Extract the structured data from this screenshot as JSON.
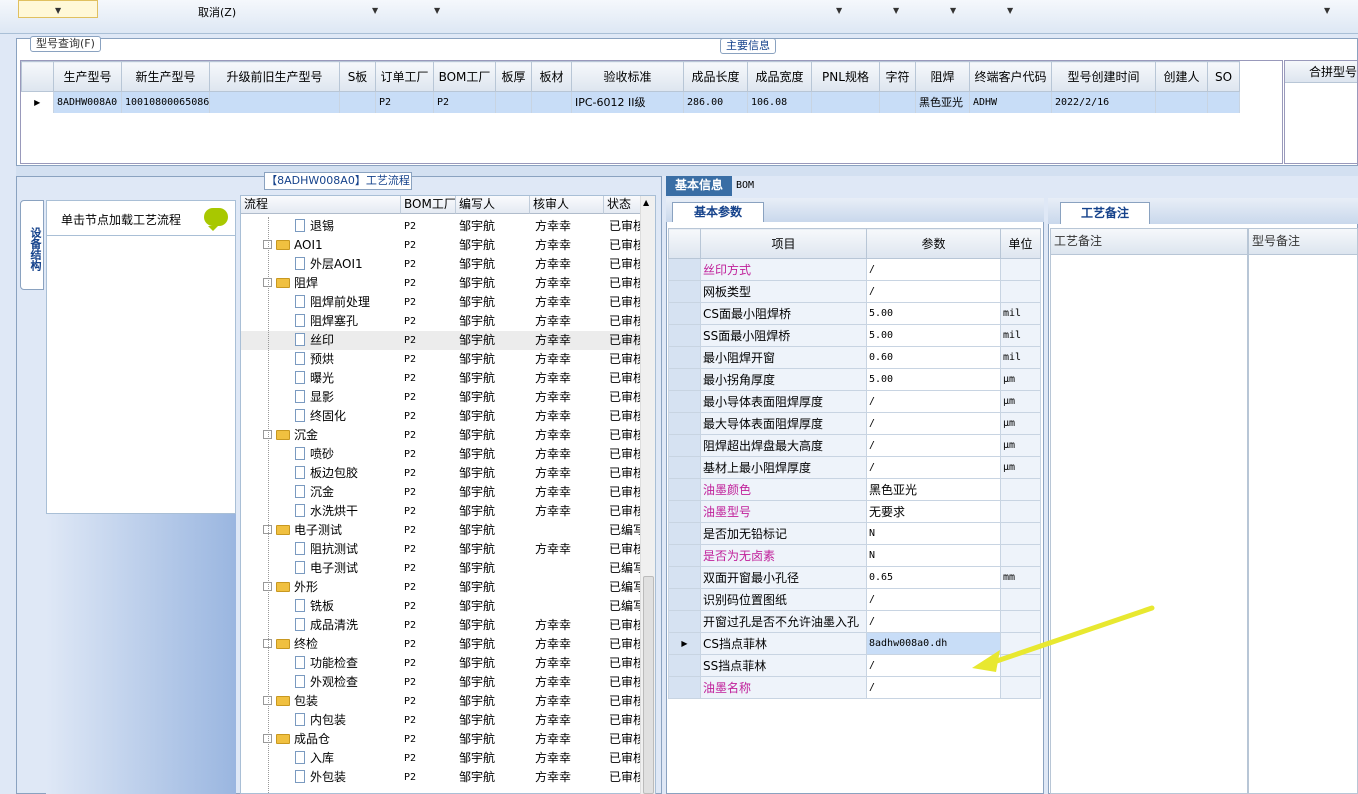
{
  "toolbar": {
    "cancel_label": "取消(Z)"
  },
  "search_panel": {
    "tab_label": "型号查询(F)",
    "main_info_label": "主要信息",
    "columns": [
      "生产型号",
      "新生产型号",
      "升级前旧生产型号",
      "S板",
      "订单工厂",
      "BOM工厂",
      "板厚",
      "板材",
      "验收标准",
      "成品长度",
      "成品宽度",
      "PNL规格",
      "字符",
      "阻焊",
      "终端客户代码",
      "型号创建时间",
      "创建人",
      "SO"
    ],
    "row": [
      "8ADHW008A0",
      "10010800065086",
      "",
      "",
      "P2",
      "P2",
      "",
      "",
      "IPC-6012 II级",
      "286.00",
      "106.08",
      "",
      "",
      "黑色亚光",
      "ADHW",
      "2022/2/16",
      "",
      ""
    ],
    "combine_label": "合拼型号"
  },
  "process": {
    "title": "【8ADHW008A0】工艺流程",
    "vertical_tab": "设备结构",
    "node_hint": "单击节点加载工艺流程",
    "columns": [
      "流程",
      "BOM工厂",
      "编写人",
      "核审人",
      "状态"
    ],
    "rows": [
      {
        "name": "退锡",
        "type": "doc",
        "indent": 2,
        "bom": "P2",
        "writer": "邹宇航",
        "reviewer": "方幸幸",
        "status": "已审核"
      },
      {
        "name": "AOI1",
        "type": "folder",
        "indent": 1,
        "bom": "P2",
        "writer": "邹宇航",
        "reviewer": "方幸幸",
        "status": "已审核"
      },
      {
        "name": "外层AOI1",
        "type": "doc",
        "indent": 2,
        "bom": "P2",
        "writer": "邹宇航",
        "reviewer": "方幸幸",
        "status": "已审核"
      },
      {
        "name": "阻焊",
        "type": "folder",
        "indent": 1,
        "bom": "P2",
        "writer": "邹宇航",
        "reviewer": "方幸幸",
        "status": "已审核"
      },
      {
        "name": "阻焊前处理",
        "type": "doc",
        "indent": 2,
        "bom": "P2",
        "writer": "邹宇航",
        "reviewer": "方幸幸",
        "status": "已审核"
      },
      {
        "name": "阻焊塞孔",
        "type": "doc",
        "indent": 2,
        "bom": "P2",
        "writer": "邹宇航",
        "reviewer": "方幸幸",
        "status": "已审核"
      },
      {
        "name": "丝印",
        "type": "doc",
        "indent": 2,
        "bom": "P2",
        "writer": "邹宇航",
        "reviewer": "方幸幸",
        "status": "已审核"
      },
      {
        "name": "预烘",
        "type": "doc",
        "indent": 2,
        "bom": "P2",
        "writer": "邹宇航",
        "reviewer": "方幸幸",
        "status": "已审核"
      },
      {
        "name": "曝光",
        "type": "doc",
        "indent": 2,
        "bom": "P2",
        "writer": "邹宇航",
        "reviewer": "方幸幸",
        "status": "已审核"
      },
      {
        "name": "显影",
        "type": "doc",
        "indent": 2,
        "bom": "P2",
        "writer": "邹宇航",
        "reviewer": "方幸幸",
        "status": "已审核"
      },
      {
        "name": "终固化",
        "type": "doc",
        "indent": 2,
        "bom": "P2",
        "writer": "邹宇航",
        "reviewer": "方幸幸",
        "status": "已审核"
      },
      {
        "name": "沉金",
        "type": "folder",
        "indent": 1,
        "bom": "P2",
        "writer": "邹宇航",
        "reviewer": "方幸幸",
        "status": "已审核"
      },
      {
        "name": "喷砂",
        "type": "doc",
        "indent": 2,
        "bom": "P2",
        "writer": "邹宇航",
        "reviewer": "方幸幸",
        "status": "已审核"
      },
      {
        "name": "板边包胶",
        "type": "doc",
        "indent": 2,
        "bom": "P2",
        "writer": "邹宇航",
        "reviewer": "方幸幸",
        "status": "已审核"
      },
      {
        "name": "沉金",
        "type": "doc",
        "indent": 2,
        "bom": "P2",
        "writer": "邹宇航",
        "reviewer": "方幸幸",
        "status": "已审核"
      },
      {
        "name": "水洗烘干",
        "type": "doc",
        "indent": 2,
        "bom": "P2",
        "writer": "邹宇航",
        "reviewer": "方幸幸",
        "status": "已审核"
      },
      {
        "name": "电子测试",
        "type": "folder",
        "indent": 1,
        "bom": "P2",
        "writer": "邹宇航",
        "reviewer": "",
        "status": "已编写"
      },
      {
        "name": "阻抗测试",
        "type": "doc",
        "indent": 2,
        "bom": "P2",
        "writer": "邹宇航",
        "reviewer": "方幸幸",
        "status": "已审核"
      },
      {
        "name": "电子测试",
        "type": "doc",
        "indent": 2,
        "bom": "P2",
        "writer": "邹宇航",
        "reviewer": "",
        "status": "已编写"
      },
      {
        "name": "外形",
        "type": "folder",
        "indent": 1,
        "bom": "P2",
        "writer": "邹宇航",
        "reviewer": "",
        "status": "已编写"
      },
      {
        "name": "铣板",
        "type": "doc",
        "indent": 2,
        "bom": "P2",
        "writer": "邹宇航",
        "reviewer": "",
        "status": "已编写"
      },
      {
        "name": "成品清洗",
        "type": "doc",
        "indent": 2,
        "bom": "P2",
        "writer": "邹宇航",
        "reviewer": "方幸幸",
        "status": "已审核"
      },
      {
        "name": "终检",
        "type": "folder",
        "indent": 1,
        "bom": "P2",
        "writer": "邹宇航",
        "reviewer": "方幸幸",
        "status": "已审核"
      },
      {
        "name": "功能检查",
        "type": "doc",
        "indent": 2,
        "bom": "P2",
        "writer": "邹宇航",
        "reviewer": "方幸幸",
        "status": "已审核"
      },
      {
        "name": "外观检查",
        "type": "doc",
        "indent": 2,
        "bom": "P2",
        "writer": "邹宇航",
        "reviewer": "方幸幸",
        "status": "已审核"
      },
      {
        "name": "包装",
        "type": "folder",
        "indent": 1,
        "bom": "P2",
        "writer": "邹宇航",
        "reviewer": "方幸幸",
        "status": "已审核"
      },
      {
        "name": "内包装",
        "type": "doc",
        "indent": 2,
        "bom": "P2",
        "writer": "邹宇航",
        "reviewer": "方幸幸",
        "status": "已审核"
      },
      {
        "name": "成品仓",
        "type": "folder",
        "indent": 1,
        "bom": "P2",
        "writer": "邹宇航",
        "reviewer": "方幸幸",
        "status": "已审核"
      },
      {
        "name": "入库",
        "type": "doc",
        "indent": 2,
        "bom": "P2",
        "writer": "邹宇航",
        "reviewer": "方幸幸",
        "status": "已审核"
      },
      {
        "name": "外包装",
        "type": "doc",
        "indent": 2,
        "bom": "P2",
        "writer": "邹宇航",
        "reviewer": "方幸幸",
        "status": "已审核"
      }
    ]
  },
  "basic_info": {
    "tab_basic": "基本信息",
    "tab_bom": "BOM",
    "sub_tab": "基本参数",
    "columns": [
      "项目",
      "参数",
      "单位"
    ],
    "rows": [
      {
        "label": "丝印方式",
        "value": "/",
        "unit": "",
        "pink": true
      },
      {
        "label": "网板类型",
        "value": "/",
        "unit": "",
        "pink": false
      },
      {
        "label": "CS面最小阻焊桥",
        "value": "5.00",
        "unit": "mil",
        "pink": false
      },
      {
        "label": "SS面最小阻焊桥",
        "value": "5.00",
        "unit": "mil",
        "pink": false
      },
      {
        "label": "最小阻焊开窗",
        "value": "0.60",
        "unit": "mil",
        "pink": false
      },
      {
        "label": "最小拐角厚度",
        "value": "5.00",
        "unit": "μm",
        "pink": false
      },
      {
        "label": "最小导体表面阻焊厚度",
        "value": "/",
        "unit": "μm",
        "pink": false
      },
      {
        "label": "最大导体表面阻焊厚度",
        "value": "/",
        "unit": "μm",
        "pink": false
      },
      {
        "label": "阻焊超出焊盘最大高度",
        "value": "/",
        "unit": "μm",
        "pink": false
      },
      {
        "label": "基材上最小阻焊厚度",
        "value": "/",
        "unit": "μm",
        "pink": false
      },
      {
        "label": "油墨颜色",
        "value": "黑色亚光",
        "unit": "",
        "pink": true
      },
      {
        "label": "油墨型号",
        "value": "无要求",
        "unit": "",
        "pink": true
      },
      {
        "label": "是否加无铅标记",
        "value": "N",
        "unit": "",
        "pink": false
      },
      {
        "label": "是否为无卤素",
        "value": "N",
        "unit": "",
        "pink": true
      },
      {
        "label": "双面开窗最小孔径",
        "value": "0.65",
        "unit": "mm",
        "pink": false
      },
      {
        "label": "识别码位置图纸",
        "value": "/",
        "unit": "",
        "pink": false
      },
      {
        "label": "开窗过孔是否不允许油墨入孔",
        "value": "/",
        "unit": "",
        "pink": false
      },
      {
        "label": "CS挡点菲林",
        "value": "8adhw008a0.dh",
        "unit": "",
        "pink": false
      },
      {
        "label": "SS挡点菲林",
        "value": "/",
        "unit": "",
        "pink": false
      },
      {
        "label": "油墨名称",
        "value": "/",
        "unit": "",
        "pink": true
      }
    ]
  },
  "notes": {
    "tab": "工艺备注",
    "col1": "工艺备注",
    "col2": "型号备注"
  },
  "colors": {
    "accent": "#3a6ea5",
    "selection": "#c8ddf7",
    "pink_label": "#c0209a",
    "arrow": "#e8e830"
  }
}
